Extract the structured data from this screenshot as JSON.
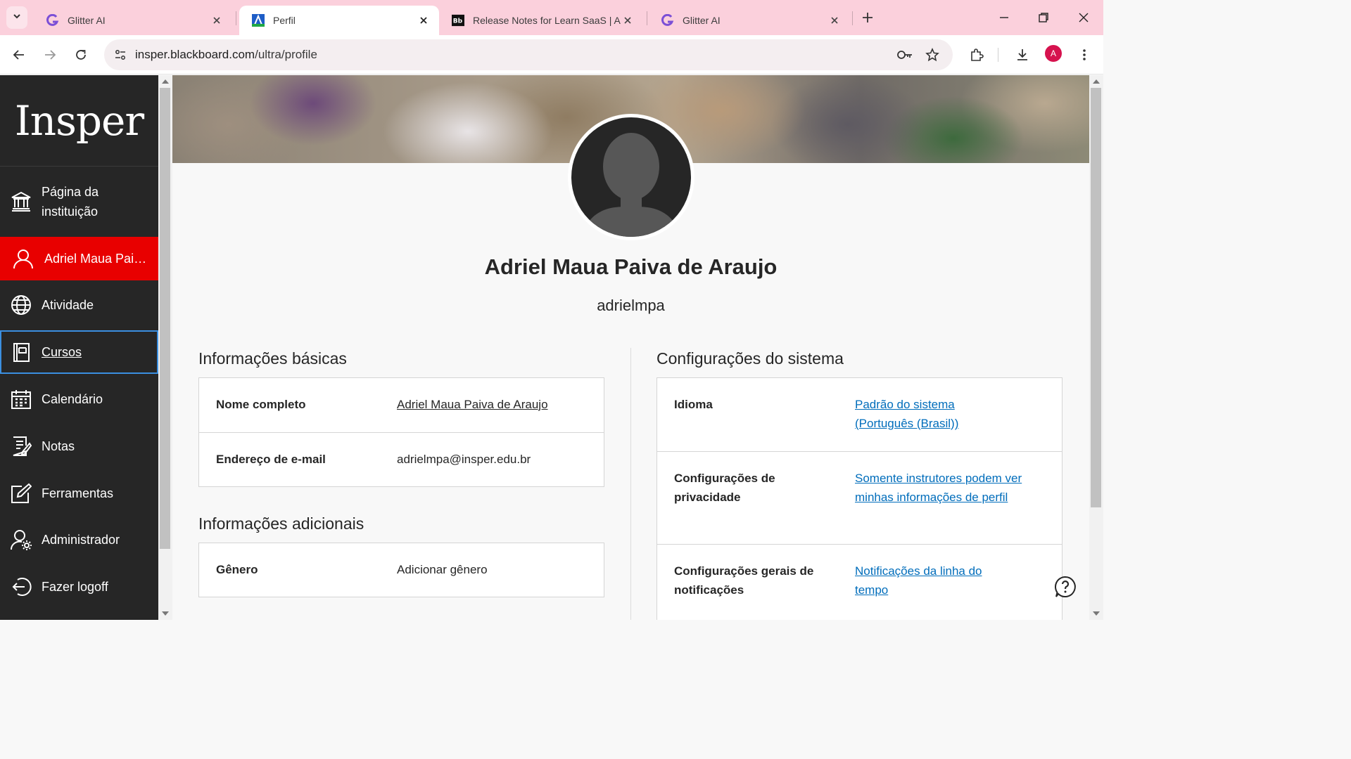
{
  "browser": {
    "tabs": [
      {
        "title": "Glitter AI",
        "active": false
      },
      {
        "title": "Perfil",
        "active": true
      },
      {
        "title": "Release Notes for Learn SaaS | A",
        "active": false
      },
      {
        "title": "Glitter AI",
        "active": false
      }
    ],
    "url_domain": "insper.blackboard.com",
    "url_path": "/ultra/profile",
    "profile_initial": "A",
    "profile_color": "#d6124e",
    "tabstrip_color": "#fbd0dc"
  },
  "sidebar": {
    "logo": "Insper",
    "items": [
      {
        "label": "Página da instituição",
        "icon": "institution-icon"
      },
      {
        "label": "Adriel Maua Paiva de Araujo",
        "icon": "user-icon",
        "selected": true
      },
      {
        "label": "Atividade",
        "icon": "globe-icon"
      },
      {
        "label": "Cursos",
        "icon": "courses-icon",
        "focused": true
      },
      {
        "label": "Calendário",
        "icon": "calendar-icon"
      },
      {
        "label": "Notas",
        "icon": "grades-icon"
      },
      {
        "label": "Ferramentas",
        "icon": "tools-icon"
      },
      {
        "label": "Administrador",
        "icon": "admin-icon"
      },
      {
        "label": "Fazer logoff",
        "icon": "logout-icon"
      }
    ],
    "selected_color": "#e80000"
  },
  "profile": {
    "full_name": "Adriel Maua Paiva de Araujo",
    "username": "adrielmpa"
  },
  "basic_info": {
    "title": "Informações básicas",
    "rows": [
      {
        "key": "Nome completo",
        "value": "Adriel Maua Paiva de Araujo"
      },
      {
        "key": "Endereço de e-mail",
        "value": "adrielmpa@insper.edu.br"
      }
    ]
  },
  "additional_info": {
    "title": "Informações adicionais",
    "rows": [
      {
        "key": "Gênero",
        "value": "Adicionar gênero"
      }
    ]
  },
  "system_settings": {
    "title": "Configurações do sistema",
    "rows": [
      {
        "key": "Idioma",
        "value": "Padrão do sistema (Português (Brasil))"
      },
      {
        "key": "Configurações de privacidade",
        "value": "Somente instrutores podem ver minhas informações de perfil"
      },
      {
        "key": "Configurações gerais de notificações",
        "value": "Notificações da linha do tempo"
      }
    ],
    "link_color": "#006dbb"
  }
}
